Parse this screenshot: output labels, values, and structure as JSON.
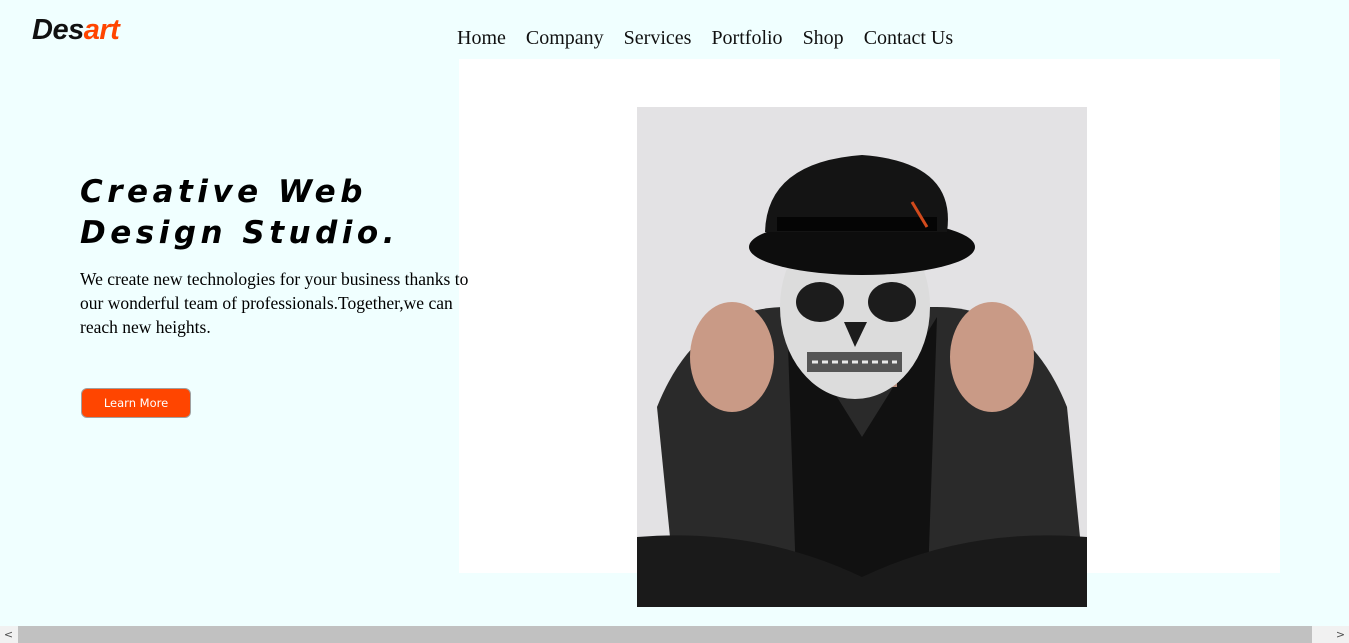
{
  "brand": {
    "part1": "Des",
    "part2": "art",
    "accent": "#ff4500"
  },
  "nav": {
    "items": [
      {
        "label": "Home"
      },
      {
        "label": "Company"
      },
      {
        "label": "Services"
      },
      {
        "label": "Portfolio"
      },
      {
        "label": "Shop"
      },
      {
        "label": "Contact Us"
      }
    ]
  },
  "hero": {
    "title_line1": "Creative Web",
    "title_line2": "Design Studio.",
    "text": "We create new technologies for your business thanks to our wonderful team of professionals.Together,we can reach new heights.",
    "button_label": "Learn More"
  },
  "colors": {
    "background": "#f0ffff",
    "panel": "#ffffff",
    "button": "#ff4500"
  },
  "scrollbar": {
    "left_arrow": "<",
    "right_arrow": ">"
  }
}
